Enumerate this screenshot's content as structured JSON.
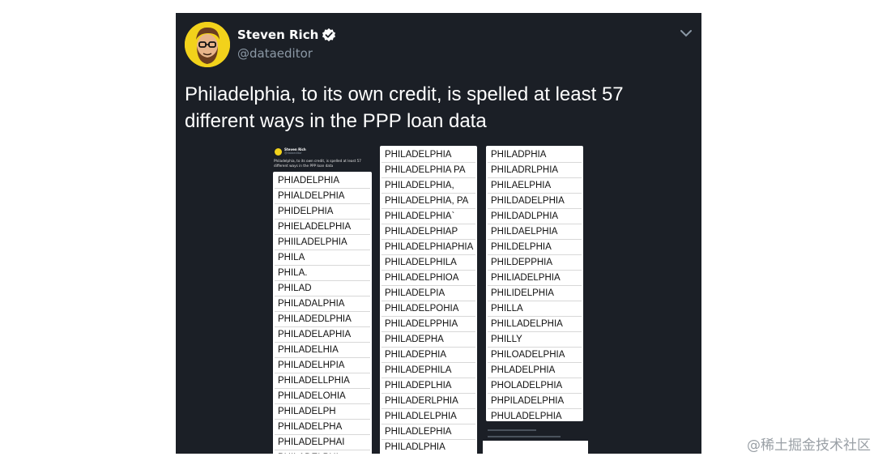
{
  "tweet": {
    "author_name": "Steven Rich",
    "author_handle": "@dataeditor",
    "text": "Philadelphia, to its own credit, is spelled at least 57 different ways in the PPP loan data"
  },
  "embedded": {
    "author_name": "Steven Rich",
    "author_handle": "@dataeditor",
    "text": "Philadelphia, to its own credit, is spelled at least 57 different ways in the PPP loan data"
  },
  "column1": [
    "PHIADELPHIA",
    "PHIALDELPHIA",
    "PHIDELPHIA",
    "PHIELADELPHIA",
    "PHIILADELPHIA",
    "PHILA",
    "PHILA.",
    "PHILAD",
    "PHILADALPHIA",
    "PHILADEDLPHIA",
    "PHILADELAPHIA",
    "PHILADELHIA",
    "PHILADELHPIA",
    "PHILADELLPHIA",
    "PHILADELOHIA",
    "PHILADELPH",
    "PHILADELPHA",
    "PHILADELPHAI",
    "PHILADELPHI"
  ],
  "column2": [
    "PHILADELPHIA",
    "PHILADELPHIA PA",
    "PHILADELPHIA,",
    "PHILADELPHIA, PA",
    "PHILADELPHIA`",
    "PHILADELPHIAP",
    "PHILADELPHIAPHIA",
    "PHILADELPHILA",
    "PHILADELPHIOA",
    "PHILADELPIA",
    "PHILADELPOHIA",
    "PHILADELPPHIA",
    "PHILADEPHA",
    "PHILADEPHIA",
    "PHILADEPHILA",
    "PHILADEPLHIA",
    "PHILADERLPHIA",
    "PHILADLELPHIA",
    "PHILADLEPHIA",
    "PHILADLPHIA"
  ],
  "column3": [
    "PHILADPHIA",
    "PHILADRLPHIA",
    "PHILAELPHIA",
    "PHILDADELPHIA",
    "PHILDADLPHIA",
    "PHILDAELPHIA",
    "PHILDELPHIA",
    "PHILDEPPHIA",
    "PHILIADELPHIA",
    "PHILIDELPHIA",
    "PHILLA",
    "PHILLADELPHIA",
    "PHILLY",
    "PHILOADELPHIA",
    "PHLADELPHIA",
    "PHOLADELPHIA",
    "PHPILADELPHIA",
    "PHULADELPHIA"
  ],
  "watermark": "@稀土掘金技术社区",
  "icons": [
    "verified-icon",
    "chevron-down-icon"
  ],
  "colors": {
    "tweet_bg": "#1b1f26",
    "avatar_bg": "#f2d21b",
    "verified": "#ffffff",
    "handle": "#8b98a5"
  }
}
